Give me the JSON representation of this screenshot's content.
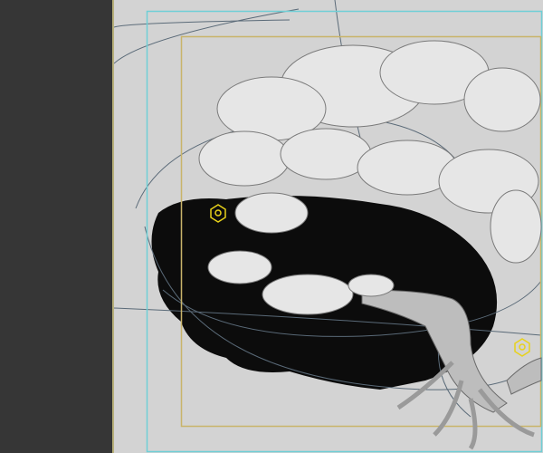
{
  "colors": {
    "side_panel": "#363636",
    "viewport_bg": "#d3d3d3",
    "safe_frame": "#6fcfd6",
    "render_frame": "#c9b46a",
    "light_icon": "#e8d21a"
  },
  "viewport": {
    "scene": "bonsai-tree",
    "lights": [
      "light-1",
      "light-2"
    ]
  }
}
